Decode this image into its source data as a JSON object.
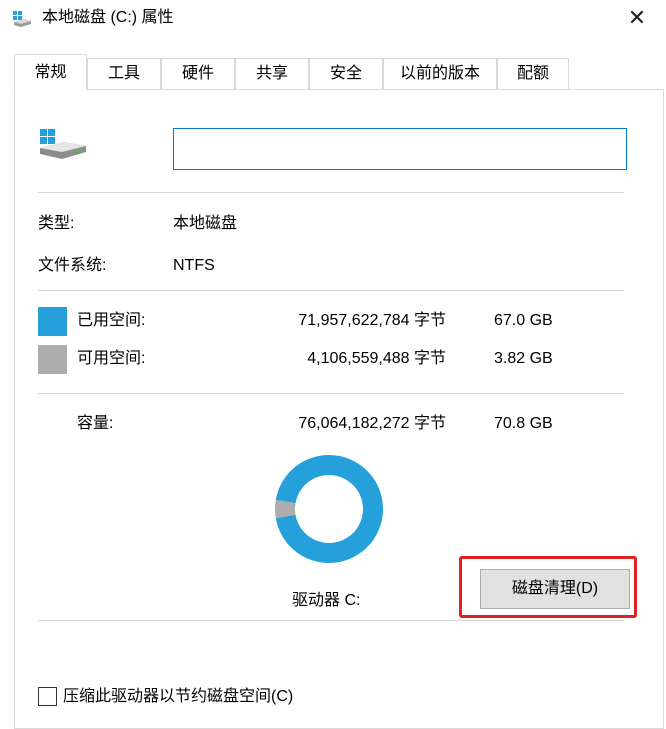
{
  "window": {
    "title": "本地磁盘 (C:) 属性",
    "close_glyph": "✕"
  },
  "tabs": [
    {
      "label": "常规",
      "active": true
    },
    {
      "label": "工具",
      "active": false
    },
    {
      "label": "硬件",
      "active": false
    },
    {
      "label": "共享",
      "active": false
    },
    {
      "label": "安全",
      "active": false
    },
    {
      "label": "以前的版本",
      "active": false
    },
    {
      "label": "配额",
      "active": false
    }
  ],
  "general": {
    "volume_label_value": "",
    "type_label": "类型:",
    "type_value": "本地磁盘",
    "fs_label": "文件系统:",
    "fs_value": "NTFS",
    "used": {
      "label": "已用空间:",
      "bytes": "71,957,622,784 字节",
      "size": "67.0 GB",
      "color": "#26a0da"
    },
    "free": {
      "label": "可用空间:",
      "bytes": "4,106,559,488 字节",
      "size": "3.82 GB",
      "color": "#adadad"
    },
    "capacity": {
      "label": "容量:",
      "bytes": "76,064,182,272 字节",
      "size": "70.8 GB"
    },
    "usage_fraction": 0.946,
    "drive_caption": "驱动器 C:",
    "cleanup_button": "磁盘清理(D)",
    "compress_checkbox": {
      "label": "压缩此驱动器以节约磁盘空间(C)",
      "checked": false
    }
  },
  "icons": {
    "title_icon": "drive-icon",
    "drive_icon": "windows-drive-icon"
  },
  "highlight_color": "#e02020"
}
